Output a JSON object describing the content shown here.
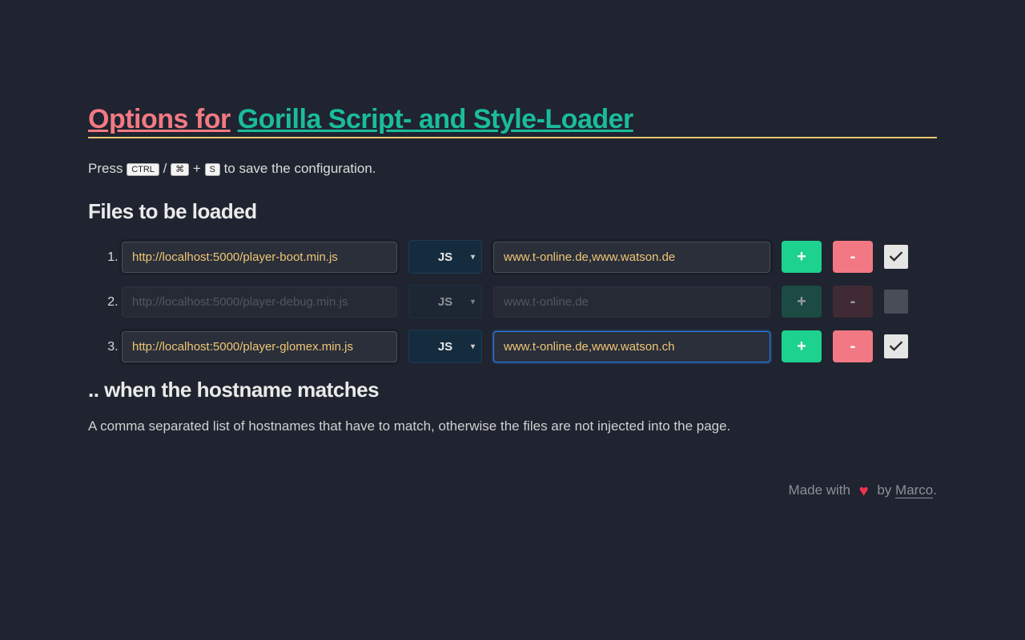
{
  "title": {
    "part1": "Options for",
    "part2": "Gorilla Script- and Style-Loader"
  },
  "saveLine": {
    "prefix": "Press ",
    "kbd1": "CTRL",
    "slash": " / ",
    "kbd2": "⌘",
    "plus": " + ",
    "kbd3": "S",
    "suffix": " to save the configuration."
  },
  "filesHeading": "Files to be loaded",
  "rows": [
    {
      "url": "http://localhost:5000/player-boot.min.js",
      "type": "JS",
      "hosts": "www.t-online.de,www.watson.de",
      "active": true,
      "checked": true,
      "focused": false
    },
    {
      "url": "http://localhost:5000/player-debug.min.js",
      "type": "JS",
      "hosts": "www.t-online.de",
      "active": false,
      "checked": false,
      "focused": false
    },
    {
      "url": "http://localhost:5000/player-glomex.min.js",
      "type": "JS",
      "hosts": "www.t-online.de,www.watson.ch",
      "active": true,
      "checked": true,
      "focused": true
    }
  ],
  "addLabel": "+",
  "removeLabel": "-",
  "hostnameHeading": ".. when the hostname matches",
  "hostnameDesc": "A comma separated list of hostnames that have to match, otherwise the files are not injected into the page.",
  "footer": {
    "made": "Made with",
    "by": "by",
    "author": "Marco",
    "period": "."
  }
}
